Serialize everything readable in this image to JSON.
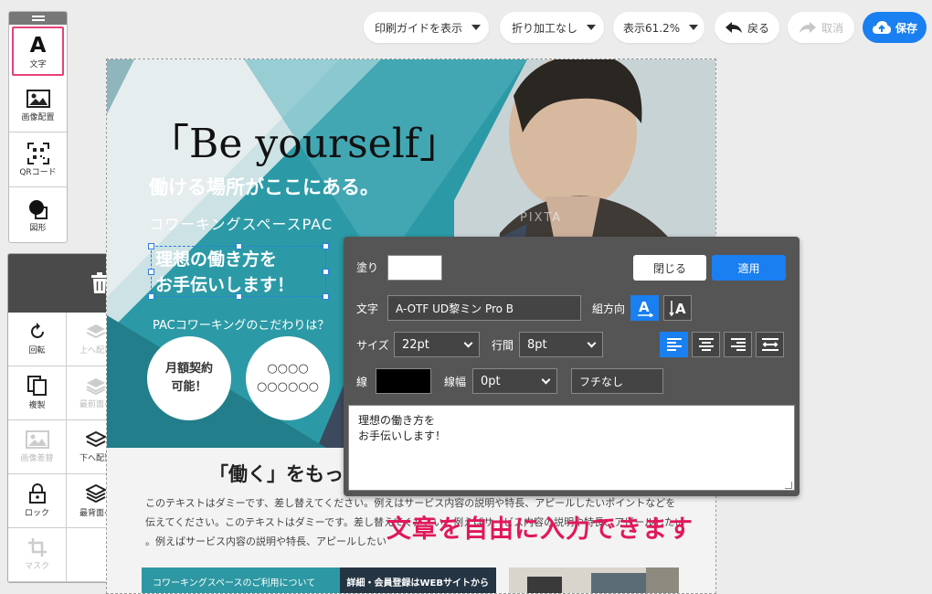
{
  "toolbar": {
    "print_guide": "印刷ガイドを表示",
    "fold": "折り加工なし",
    "zoom": "表示61.2%",
    "back": "戻る",
    "cancel": "取消",
    "save": "保存"
  },
  "tools": [
    {
      "label": "文字",
      "icon": "text-icon",
      "active": true
    },
    {
      "label": "画像配置",
      "icon": "image-icon",
      "active": false
    },
    {
      "label": "QRコード",
      "icon": "qr-code-icon",
      "active": false
    },
    {
      "label": "図形",
      "icon": "shape-icon",
      "active": false
    }
  ],
  "edit_actions": [
    {
      "label": "回転",
      "icon": "rotate-icon",
      "enabled": true
    },
    {
      "label": "上へ配置",
      "icon": "layer-up-icon",
      "enabled": false
    },
    {
      "label": "複製",
      "icon": "duplicate-icon",
      "enabled": true
    },
    {
      "label": "最前面へ",
      "icon": "layer-front-icon",
      "enabled": false
    },
    {
      "label": "画像差替",
      "icon": "image-replace-icon",
      "enabled": false
    },
    {
      "label": "下へ配置",
      "icon": "layer-down-icon",
      "enabled": true
    },
    {
      "label": "ロック",
      "icon": "lock-icon",
      "enabled": true
    },
    {
      "label": "最背面へ",
      "icon": "layer-back-icon",
      "enabled": true
    },
    {
      "label": "マスク",
      "icon": "crop-icon",
      "enabled": false
    }
  ],
  "flyer": {
    "title": "「Be yourself」",
    "subtitle": "働ける場所がここにある。",
    "brand": "コワーキングスペースPAC",
    "edit_text": "理想の働き方を\nお手伝いします！",
    "commitment": "PACコワーキングのこだわりは？",
    "circle1": "月額契約\n可能！",
    "circle2": "○○○○\n○○○○○○",
    "watermark": "PIXTA",
    "section_title": "「働く」をもっ",
    "body_lines": [
      "このテキストはダミーです、差し替えてください。例えはサービス内容の説明や特長、アピールしたいポイントなどを",
      "伝えてください。このテキストはダミーです。差し替えてください。例えばサービス内容の説明や特長、アピールしたい",
      "。例えばサービス内容の説明や特長、アピールしたい"
    ],
    "info_left": "コワーキングスペースのご利用について",
    "info_right": "詳細・会員登録はWEBサイトから",
    "colors": {
      "teal": "#2b9aa6",
      "dark_teal": "#1f6f7c",
      "slate": "#3d4a5e"
    }
  },
  "dialog": {
    "fill_label": "塗り",
    "fill_color": "#ffffff",
    "close": "閉じる",
    "apply": "適用",
    "font_label": "文字",
    "font_value": "A-OTF UD黎ミン Pro B",
    "direction_label": "組方向",
    "size_label": "サイズ",
    "size_value": "22pt",
    "leading_label": "行間",
    "leading_value": "8pt",
    "stroke_label": "線",
    "stroke_color": "#000000",
    "stroke_width_label": "線幅",
    "stroke_width_value": "0pt",
    "border_value": "フチなし",
    "text_value": "理想の働き方を\nお手伝いします！"
  },
  "annotation": "文章を自由に入力できます"
}
